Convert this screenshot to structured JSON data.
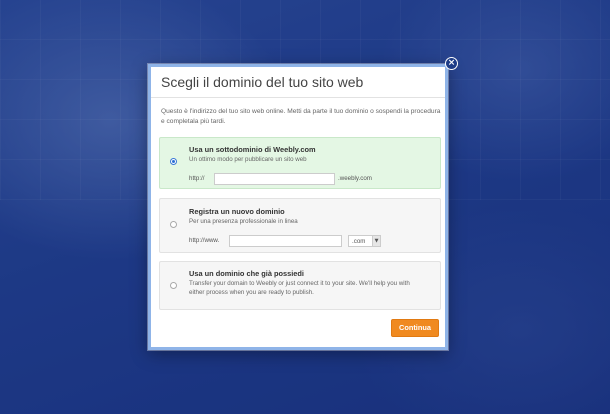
{
  "dialog": {
    "title": "Scegli il dominio del tuo sito web",
    "intro": "Questo è l'indirizzo del tuo sito web online. Metti da parte il tuo dominio o sospendi la procedura e completala più tardi.",
    "close_icon": "close-icon",
    "options": [
      {
        "title": "Usa un sottodominio di Weebly.com",
        "subtitle": "Un ottimo modo per pubblicare un sito web",
        "prefix": "http://",
        "value": "",
        "suffix": ".weebly.com",
        "selected": true
      },
      {
        "title": "Registra un nuovo dominio",
        "subtitle": "Per una presenza professionale in linea",
        "prefix": "http://www.",
        "value": "",
        "tld": ".com",
        "selected": false
      },
      {
        "title": "Usa un dominio che già possiedi",
        "subtitle": "Transfer your domain to Weebly or just connect it to your site. We'll help you with either process when you are ready to publish.",
        "selected": false
      }
    ],
    "continue_label": "Continua"
  },
  "colors": {
    "background": "#1f3b86",
    "selected_option": "#e4f7e4",
    "continue_button": "#f08a20"
  }
}
